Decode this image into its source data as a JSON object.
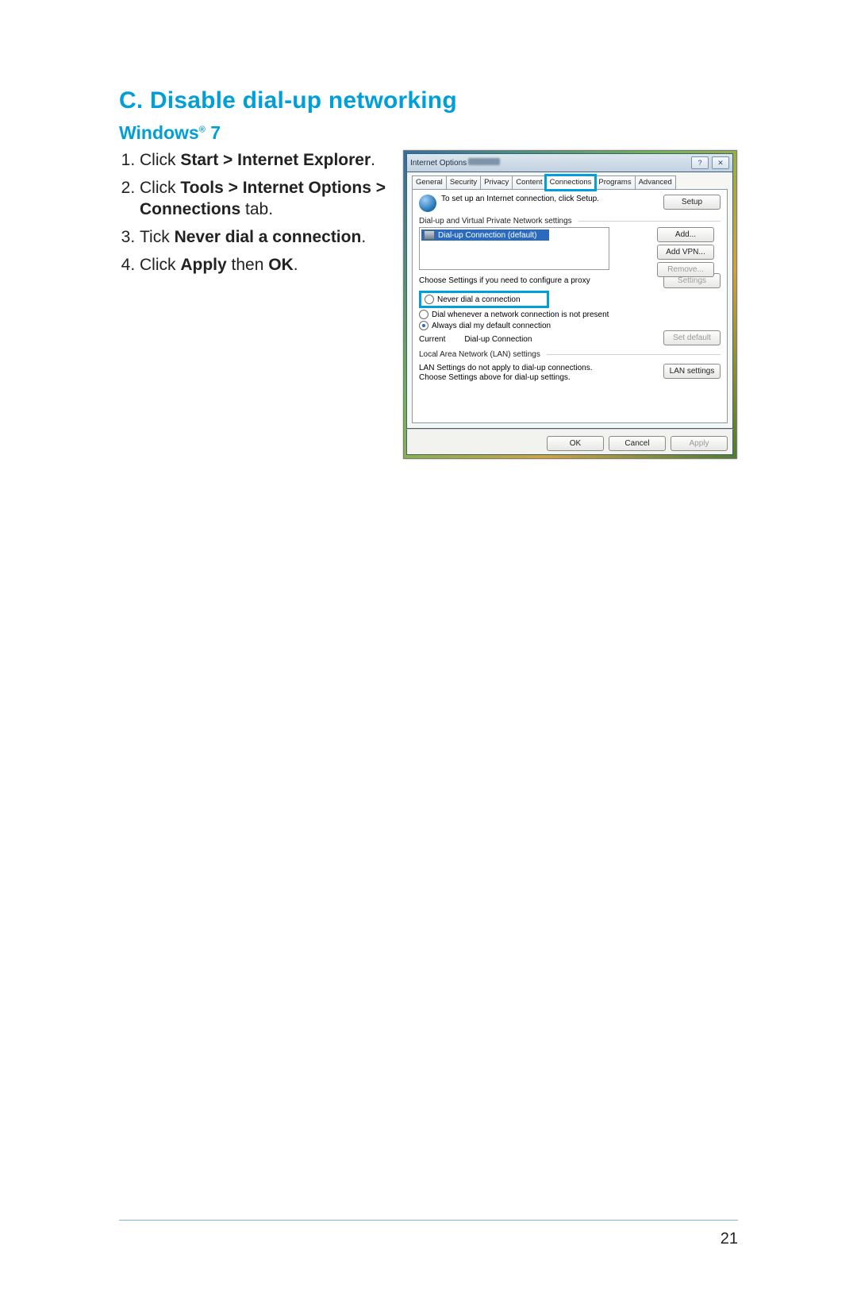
{
  "heading": "C.    Disable dial-up networking",
  "subheading_prefix": "Windows",
  "subheading_suffix": " 7",
  "steps": [
    {
      "pre": "Click ",
      "bold": "Start > Internet Explorer",
      "post": "."
    },
    {
      "pre": "Click ",
      "bold": "Tools > Internet Options > Connections",
      "post": " tab."
    },
    {
      "pre": "Tick ",
      "bold": "Never dial a connection",
      "post": "."
    },
    {
      "pre": "Click ",
      "bold": "Apply",
      "mid": " then ",
      "bold2": "OK",
      "post": "."
    }
  ],
  "dialog": {
    "title": "Internet Options",
    "help_glyph": "?",
    "close_glyph": "✕",
    "tabs": [
      "General",
      "Security",
      "Privacy",
      "Content",
      "Connections",
      "Programs",
      "Advanced"
    ],
    "active_tab": "Connections",
    "setup_text": "To set up an Internet connection, click Setup.",
    "setup_button": "Setup",
    "dialup_legend": "Dial-up and Virtual Private Network settings",
    "dialup_item": "Dial-up Connection (default)",
    "add_button": "Add...",
    "addvpn_button": "Add VPN...",
    "remove_button": "Remove...",
    "proxy_text": "Choose Settings if you need to configure a proxy",
    "settings_button": "Settings",
    "radio_never": "Never dial a connection",
    "radio_whenever": "Dial whenever a network connection is not present",
    "radio_always": "Always dial my default connection",
    "current_label": "Current",
    "current_value": "Dial-up Connection",
    "setdefault_button": "Set default",
    "lan_legend": "Local Area Network (LAN) settings",
    "lan_text": "LAN Settings do not apply to dial-up connections. Choose Settings above for dial-up settings.",
    "lan_button": "LAN settings",
    "ok_button": "OK",
    "cancel_button": "Cancel",
    "apply_button": "Apply"
  },
  "page_number": "21"
}
